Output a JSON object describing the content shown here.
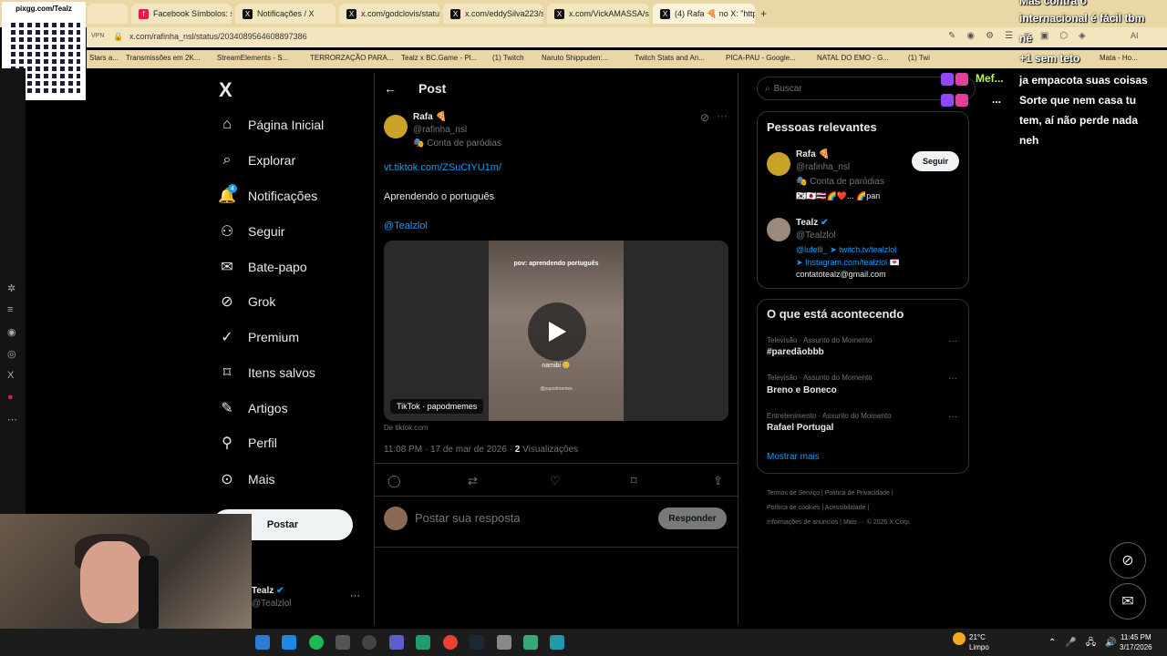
{
  "browser": {
    "tabs": [
      {
        "label": "",
        "icon": "blank-tab-icon"
      },
      {
        "label": "Facebook Símbolos: sím",
        "icon": "facebook-icon"
      },
      {
        "label": "Notificações / X",
        "icon": "x-icon"
      },
      {
        "label": "x.com/godclovis/status",
        "icon": "x-icon"
      },
      {
        "label": "x.com/eddySilva223/stat",
        "icon": "x-icon"
      },
      {
        "label": "x.com/VickAMASSA/stat",
        "icon": "x-icon"
      },
      {
        "label": "(4) Rafa 🍕 no X: \"https:",
        "icon": "x-icon"
      }
    ],
    "vpn_label": "VPN",
    "url": "x.com/rafinha_nsl/status/2034089564608897386",
    "bookmarks": [
      "Stars a...",
      "Transmissões em 2K...",
      "StreamElements - S...",
      "TERRORZAÇÃO PARA...",
      "Tealz x BC.Game - Pl...",
      "(1) Twitch",
      "Naruto Shippuden:...",
      "Twitch Stats and An...",
      "PICA-PAU - Google...",
      "NATAL DO EMO - G...",
      "(1) Twi",
      "Mata - Ho..."
    ]
  },
  "overlay": {
    "qr_label": "pixgg.com/Tealz",
    "chat": [
      {
        "user": "Mef...",
        "msg": ""
      },
      {
        "user": "",
        "msg": "..."
      }
    ],
    "chat_right": [
      "Mas contra o",
      "internacional é fácil tbm",
      "né",
      "+1 sem teto",
      "ja empacota suas coisas",
      "Sorte que nem casa tu",
      "tem, aí não perde nada",
      "neh"
    ]
  },
  "nav": {
    "logo": "X",
    "items": [
      {
        "label": "Página Inicial",
        "icon": "home-icon"
      },
      {
        "label": "Explorar",
        "icon": "search-icon"
      },
      {
        "label": "Notificações",
        "icon": "bell-icon",
        "badge": "4"
      },
      {
        "label": "Seguir",
        "icon": "follow-icon"
      },
      {
        "label": "Bate-papo",
        "icon": "mail-icon"
      },
      {
        "label": "Grok",
        "icon": "grok-icon"
      },
      {
        "label": "Premium",
        "icon": "verified-icon"
      },
      {
        "label": "Itens salvos",
        "icon": "bookmark-icon"
      },
      {
        "label": "Artigos",
        "icon": "article-icon"
      },
      {
        "label": "Perfil",
        "icon": "person-icon"
      },
      {
        "label": "Mais",
        "icon": "more-circle-icon"
      }
    ],
    "post_button": "Postar",
    "account_name": "Tealz",
    "account_handle": "@Tealzlol",
    "account_more": "···"
  },
  "post": {
    "header_title": "Post",
    "author_name": "Rafa 🍕",
    "author_handle": "@rafinha_nsl",
    "author_label": "Conta de paródias",
    "link": "vt.tiktok.com/ZSuCtYU1m/",
    "text": "Aprendendo o português",
    "mention": "@Tealzlol",
    "video_caption_top": "pov: aprendendo português",
    "video_caption_mid": "namibi 😊",
    "video_watermark": "@papodmemes",
    "video_label": "TikTok · papodmemes",
    "source": "De tiktok.com",
    "timestamp": "11:08 PM · 17 de mar de 2026 ·",
    "views_count": "2",
    "views_label": "Visualizações",
    "reply_placeholder": "Postar sua resposta",
    "reply_button": "Responder"
  },
  "right": {
    "search_placeholder": "Buscar",
    "relevant_title": "Pessoas relevantes",
    "people": [
      {
        "name": "Rafa 🍕",
        "handle": "@rafinha_nsl",
        "line1": "Conta de paródias",
        "line2": "🇰🇷🇯🇵🇹🇭🌈❤️... 🌈pan"
      },
      {
        "name": "Tealz",
        "handle": "@Tealzlol",
        "line1": "@lufelli_ ➤ twitch.tv/tealzlol",
        "line2": "➤ Instagram.com/tealzlol 💌",
        "line3": "contatotealz@gmail.com"
      }
    ],
    "follow_button": "Seguir",
    "trending_title": "O que está acontecendo",
    "trends": [
      {
        "context": "Televisão · Assunto do Momento",
        "topic": "#paredãobbb"
      },
      {
        "context": "Televisão · Assunto do Momento",
        "topic": "Breno e Boneco"
      },
      {
        "context": "Entretenimento · Assunto do Momento",
        "topic": "Rafael Portugal"
      }
    ],
    "show_more": "Mostrar mais",
    "footer": [
      "Termos de Serviço",
      "Política de Privacidade",
      "Política de cookies",
      "Acessibilidade",
      "Informações de anúncios",
      "Mais ···",
      "© 2026 X Corp."
    ]
  },
  "taskbar": {
    "weather_temp": "21°C",
    "weather_desc": "Limpo",
    "time": "11:45 PM",
    "date": "3/17/2026"
  },
  "colors": {
    "accent": "#1d9bf0",
    "background": "#000000",
    "muted": "#71767b",
    "border": "#2f3336"
  }
}
